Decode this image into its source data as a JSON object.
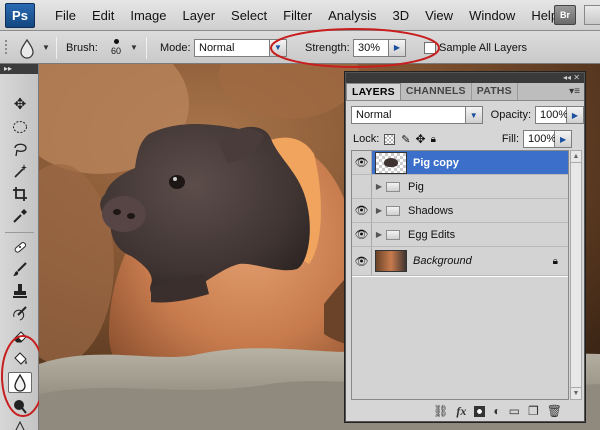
{
  "app": {
    "logo": "Ps"
  },
  "menubar": {
    "items": [
      "File",
      "Edit",
      "Image",
      "Layer",
      "Select",
      "Filter",
      "Analysis",
      "3D",
      "View",
      "Window",
      "Help"
    ],
    "bridge_label": "Br"
  },
  "options": {
    "brush_label": "Brush:",
    "brush_size": "60",
    "mode_label": "Mode:",
    "mode_value": "Normal",
    "strength_label": "Strength:",
    "strength_value": "30%",
    "sample_all_layers_label": "Sample All Layers"
  },
  "panel": {
    "tabs": [
      "LAYERS",
      "CHANNELS",
      "PATHS"
    ],
    "blend_mode": "Normal",
    "opacity_label": "Opacity:",
    "opacity_value": "100%",
    "lock_label": "Lock:",
    "fill_label": "Fill:",
    "fill_value": "100%",
    "layers": [
      {
        "name": "Pig copy",
        "visible": true,
        "selected": true,
        "type": "pixel"
      },
      {
        "name": "Pig",
        "visible": false,
        "selected": false,
        "type": "group"
      },
      {
        "name": "Shadows",
        "visible": true,
        "selected": false,
        "type": "group"
      },
      {
        "name": "Egg Edits",
        "visible": true,
        "selected": false,
        "type": "group"
      },
      {
        "name": "Background",
        "visible": true,
        "selected": false,
        "type": "background",
        "locked": true
      }
    ]
  },
  "colors": {
    "selection_blue": "#3b6fc9",
    "annotation_red": "#c81e1e"
  }
}
